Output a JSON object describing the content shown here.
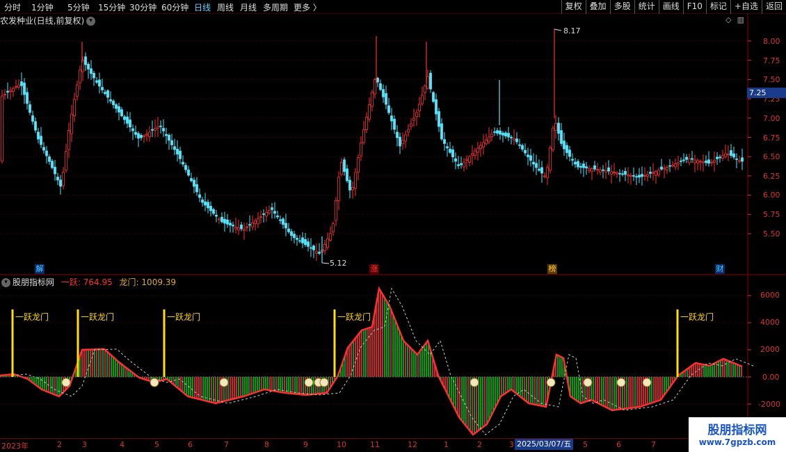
{
  "toolbar": {
    "periods": [
      "分时",
      "1分钟",
      "5分钟",
      "15分钟",
      "30分钟",
      "60分钟",
      "日线",
      "周线",
      "月线",
      "多周期",
      "更多 〉"
    ],
    "actions": [
      "复权",
      "叠加",
      "多股",
      "统计",
      "画线",
      "F10",
      "标记",
      "+自选",
      "返回"
    ]
  },
  "stock": {
    "title": "农发种业(日线,前复权)"
  },
  "price_axis": [
    "8.00",
    "7.75",
    "7.50",
    "7.25",
    "7.00",
    "6.75",
    "6.50",
    "6.25",
    "6.00",
    "5.75",
    "5.50"
  ],
  "current_price": "7.25",
  "annotations": {
    "high": "8.17",
    "low": "5.12"
  },
  "markers": [
    {
      "label": "解",
      "color": "#3ad0ff"
    },
    {
      "label": "涨",
      "color": "#ff3030"
    },
    {
      "label": "榜",
      "color": "#ffcc33"
    },
    {
      "label": "财",
      "color": "#3ad0ff"
    }
  ],
  "indicator": {
    "name": "股朋指标网",
    "v1_label": "一跃",
    "v1_value": "764.95",
    "v2_label": "龙门",
    "v2_value": "1009.39",
    "signal_label": "一跃龙门",
    "axis": [
      "6000",
      "4000",
      "2000",
      "0.00",
      "-2000"
    ]
  },
  "date_axis": {
    "ticks": [
      "2023年",
      "2",
      "3",
      "4",
      "5",
      "6",
      "7",
      "8",
      "9",
      "10",
      "11",
      "12",
      "1",
      "2",
      "3",
      "5",
      "6",
      "7"
    ],
    "highlight": "2025/03/07/五"
  },
  "watermark": {
    "line1": "股朋指标网",
    "line2": "www.7gpzb.com"
  },
  "colors": {
    "up": "#ff3030",
    "down": "#50e8ff",
    "bar_green": "#00cc00",
    "signal": "#ffe000",
    "axis": "#d33333"
  }
}
